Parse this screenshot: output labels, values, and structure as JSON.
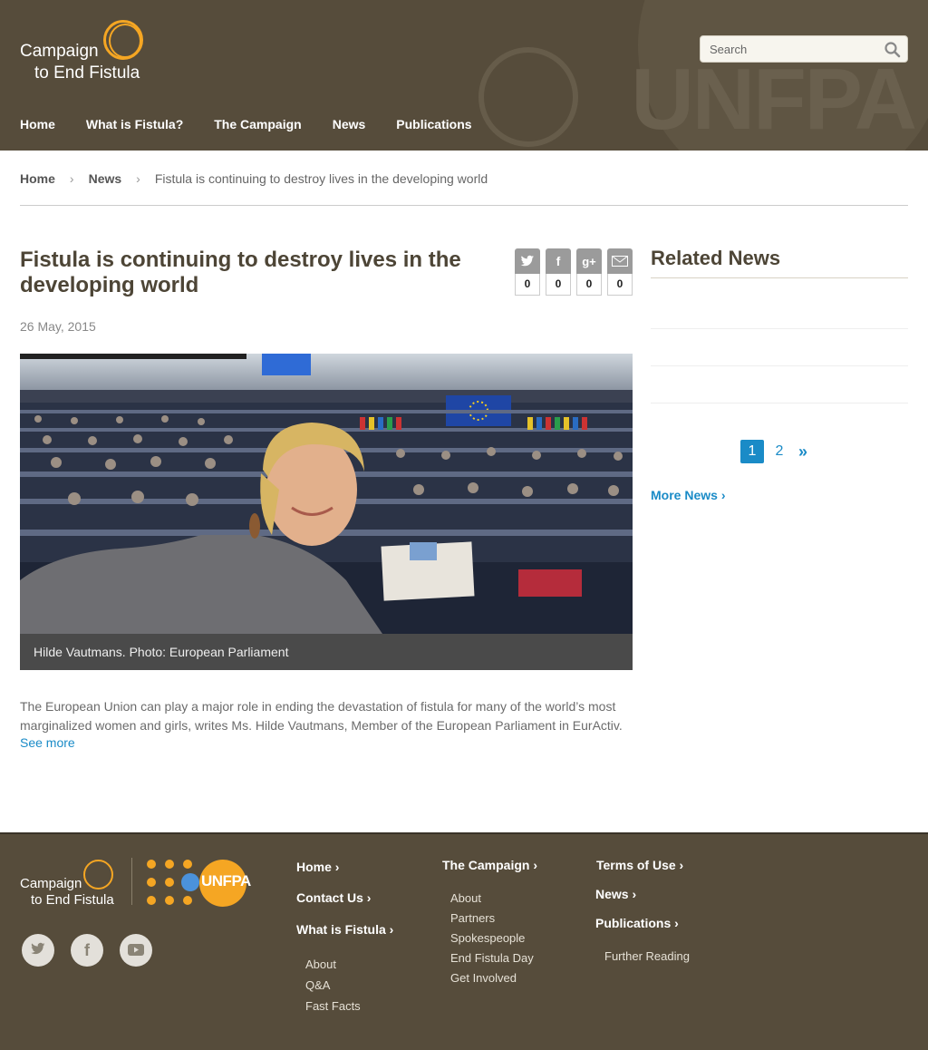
{
  "header": {
    "logo_line1": "Campaign",
    "logo_line2": "to End Fistula",
    "search_placeholder": "Search",
    "bg_text": "UNFPA",
    "nav": [
      "Home",
      "What is Fistula?",
      "The Campaign",
      "News",
      "Publications"
    ]
  },
  "breadcrumb": {
    "home": "Home",
    "news": "News",
    "current": "Fistula is continuing to destroy lives in the developing world"
  },
  "article": {
    "title": "Fistula is continuing to destroy lives in the developing world",
    "date": "26 May, 2015",
    "share": [
      {
        "icon": "twitter-icon",
        "glyph": "t",
        "count": "0"
      },
      {
        "icon": "facebook-icon",
        "glyph": "f",
        "count": "0"
      },
      {
        "icon": "google-plus-icon",
        "glyph": "g+",
        "count": "0"
      },
      {
        "icon": "email-icon",
        "glyph": "✉",
        "count": "0"
      }
    ],
    "caption": "Hilde Vautmans. Photo: European Parliament",
    "body": "The European Union can play a major role in ending the devastation of fistula for many of the world’s most marginalized women and girls, writes Ms. Hilde Vautmans, Member of the European Parliament in EurActiv.",
    "see_more": "See more"
  },
  "sidebar": {
    "related_title": "Related News",
    "pages": [
      "1",
      "2"
    ],
    "next": "»",
    "more_news": "More News"
  },
  "footer": {
    "logo_line1": "Campaign",
    "logo_line2": "to End Fistula",
    "unfpa": "UNFPA",
    "col1": {
      "links": [
        "Home",
        "Contact Us",
        "What is Fistula"
      ],
      "sub": [
        "About",
        "Q&A",
        "Fast Facts"
      ]
    },
    "col2": {
      "head": "The Campaign",
      "sub": [
        "About",
        "Partners",
        "Spokespeople",
        "End Fistula Day",
        "Get Involved"
      ]
    },
    "col3": {
      "links": [
        "Terms of Use",
        "News",
        "Publications"
      ],
      "sub": [
        "Further Reading"
      ]
    },
    "social": [
      "twitter-icon",
      "facebook-icon",
      "youtube-icon"
    ]
  },
  "colors": {
    "header_bg": "#564c3b",
    "accent": "#1a8bc7",
    "logo_orange": "#f5a623",
    "caption_bg": "#4a4a4a"
  }
}
